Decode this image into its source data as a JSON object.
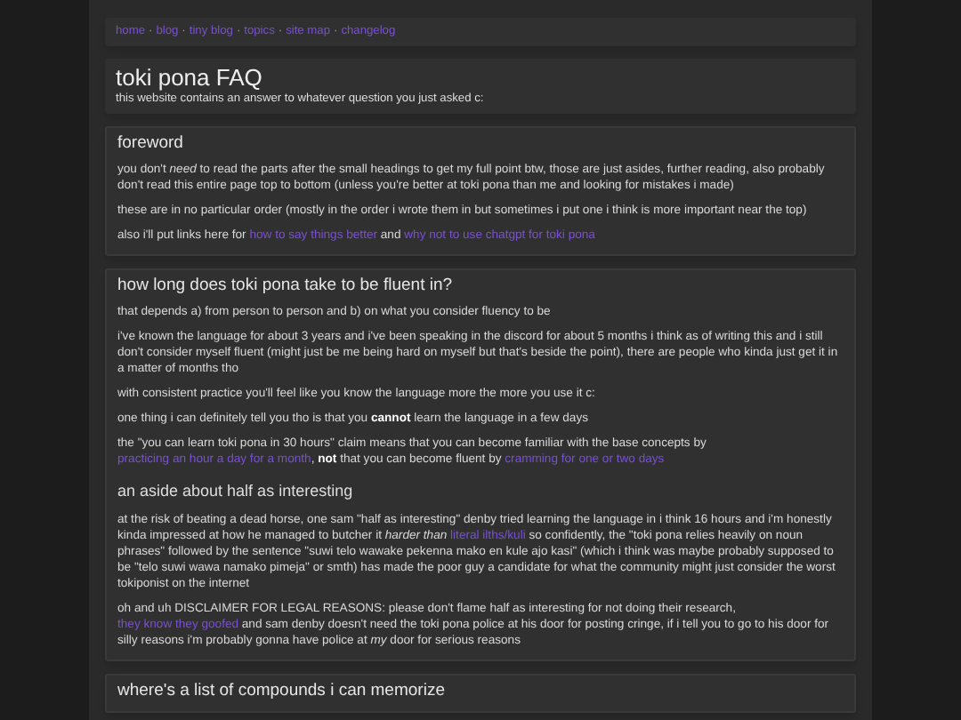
{
  "nav": [
    {
      "label": "home"
    },
    {
      "label": "blog"
    },
    {
      "label": "tiny blog"
    },
    {
      "label": "topics"
    },
    {
      "label": "site map"
    },
    {
      "label": "changelog"
    }
  ],
  "nav_separator": "·",
  "header": {
    "title": "toki pona FAQ",
    "subtitle": "this website contains an answer to whatever question you just asked c:"
  },
  "sections": [
    {
      "title": "foreword",
      "blocks": [
        {
          "kind": "paragraph",
          "segments": [
            {
              "kind": "text",
              "text": "you don't "
            },
            {
              "kind": "italic",
              "text": "need"
            },
            {
              "kind": "text",
              "text": " to read the parts after the small headings to get my full point btw, those are just asides, further reading, also probably don't read this entire page top to bottom (unless you're better at toki pona than me and looking for mistakes i made)"
            }
          ]
        },
        {
          "kind": "paragraph",
          "segments": [
            {
              "kind": "text",
              "text": "these are in no particular order (mostly in the order i wrote them in but sometimes i put one i think is more important near the top)"
            }
          ]
        },
        {
          "kind": "paragraph",
          "segments": [
            {
              "kind": "text",
              "text": "also i'll put links here for "
            },
            {
              "kind": "link",
              "text": "how to say things better"
            },
            {
              "kind": "text",
              "text": " and "
            },
            {
              "kind": "link",
              "text": "why not to use chatgpt for toki pona"
            }
          ]
        }
      ]
    },
    {
      "title": "how long does toki pona take to be fluent in?",
      "blocks": [
        {
          "kind": "paragraph",
          "segments": [
            {
              "kind": "text",
              "text": "that depends a) from person to person and b) on what you consider fluency to be"
            }
          ]
        },
        {
          "kind": "paragraph",
          "segments": [
            {
              "kind": "text",
              "text": "i've known the language for about 3 years and i've been speaking in the discord for about 5 months i think as of writing this and i still don't consider myself fluent (might just be me being hard on myself but that's beside the point), there are people who kinda just get it in a matter of months tho"
            }
          ]
        },
        {
          "kind": "paragraph",
          "segments": [
            {
              "kind": "text",
              "text": "with consistent practice you'll feel like you know the language more the more you use it c:"
            }
          ]
        },
        {
          "kind": "paragraph",
          "segments": [
            {
              "kind": "text",
              "text": "one thing i can definitely tell you tho is that you "
            },
            {
              "kind": "bold",
              "text": "cannot"
            },
            {
              "kind": "text",
              "text": " learn the language in a few days"
            }
          ]
        },
        {
          "kind": "paragraph",
          "segments": [
            {
              "kind": "text",
              "text": "the \"you can learn toki pona in 30 hours\" claim means that you can become familiar with the base concepts by "
            },
            {
              "kind": "link",
              "text": "practicing an hour a day for a month"
            },
            {
              "kind": "text",
              "text": ", "
            },
            {
              "kind": "bold",
              "text": "not"
            },
            {
              "kind": "text",
              "text": " that you can become fluent by "
            },
            {
              "kind": "link",
              "text": "cramming for one or two days"
            }
          ]
        },
        {
          "kind": "subheading",
          "text": "an aside about half as interesting"
        },
        {
          "kind": "paragraph",
          "segments": [
            {
              "kind": "text",
              "text": "at the risk of beating a dead horse, one sam \"half as interesting\" denby tried learning the language in i think 16 hours and i'm honestly kinda impressed at how he managed to butcher it "
            },
            {
              "kind": "italic",
              "text": "harder than "
            },
            {
              "kind": "link",
              "text": "literal ilths/kuli"
            },
            {
              "kind": "text",
              "text": " so confidently, the \"toki pona relies heavily on noun phrases\" followed by the sentence \"suwi telo wawake pekenna mako en kule ajo kasi\" (which i think was maybe probably supposed to be \"telo suwi wawa namako pimeja\" or smth) has made the poor guy a candidate for what the community might just consider the worst tokiponist on the internet"
            }
          ]
        },
        {
          "kind": "paragraph",
          "segments": [
            {
              "kind": "text",
              "text": "oh and uh DISCLAIMER FOR LEGAL REASONS: please don't flame half as interesting for not doing their research, "
            },
            {
              "kind": "link",
              "text": "they know they goofed"
            },
            {
              "kind": "text",
              "text": " and sam denby doesn't need the toki pona police at his door for posting cringe, if i tell you to go to his door for silly reasons i'm probably gonna have police at "
            },
            {
              "kind": "italic",
              "text": "my"
            },
            {
              "kind": "text",
              "text": " door for serious reasons"
            }
          ]
        }
      ]
    },
    {
      "title": "where's a list of compounds i can memorize"
    }
  ]
}
